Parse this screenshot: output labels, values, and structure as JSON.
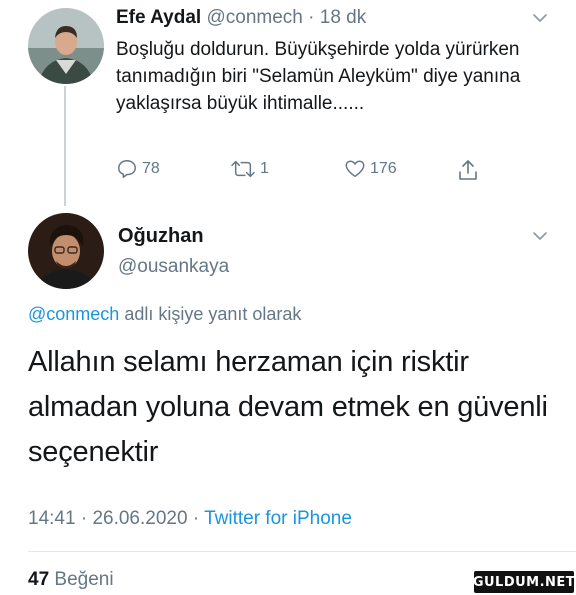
{
  "quoted_tweet": {
    "author_name": "Efe Aydal",
    "handle": "@conmech",
    "separator": "·",
    "time_ago": "18 dk",
    "text": "Boşluğu doldurun. Büyükşehirde yolda yürürken tanımadığın biri \"Selamün Aleyküm\" diye yanına yaklaşırsa büyük ihtimalle......",
    "replies": "78",
    "retweets": "1",
    "likes": "176"
  },
  "reply_tweet": {
    "author_name": "Oğuzhan",
    "handle": "@ousankaya",
    "replying_to_mention": "@conmech",
    "replying_to_suffix": " adlı kişiye yanıt olarak",
    "text": "Allahın selamı herzaman için risktir almadan yoluna devam etmek en güvenli seçenektir",
    "time": "14:41",
    "separator": "·",
    "date": "26.06.2020",
    "separator2": "·",
    "source": "Twitter for iPhone",
    "like_count": "47",
    "like_label": "Beğeni"
  },
  "watermark": "GULDUM.NET",
  "colors": {
    "link": "#1b95e0",
    "muted": "#657786",
    "text": "#14171a",
    "line": "#cbd2d8"
  },
  "icons": [
    "reply-icon",
    "retweet-icon",
    "like-icon",
    "share-icon",
    "chevron-down-icon"
  ]
}
